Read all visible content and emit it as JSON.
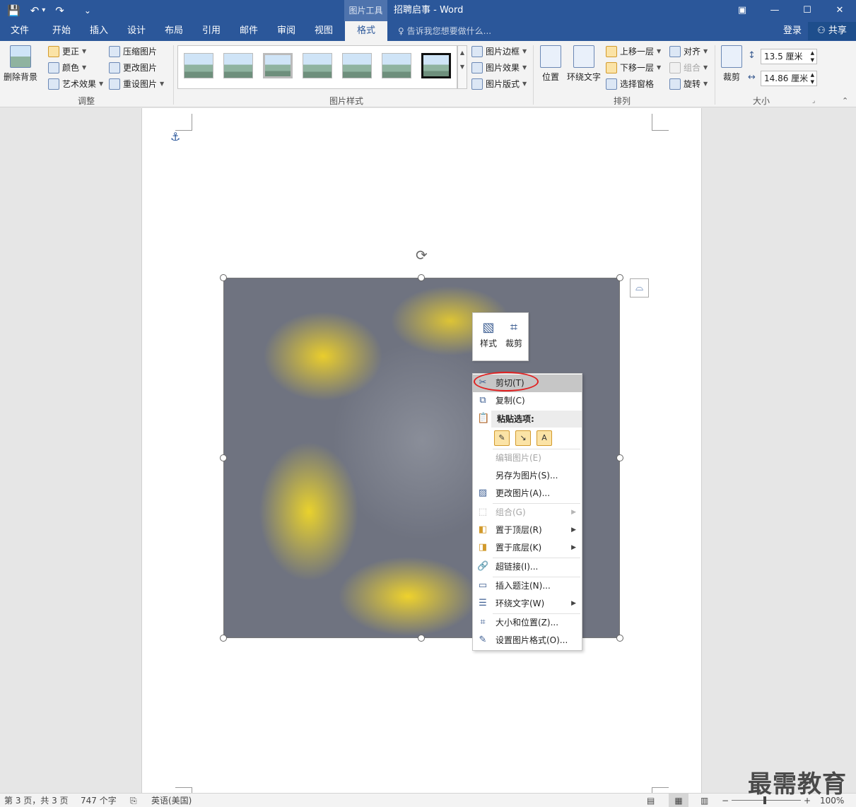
{
  "titlebar": {
    "qat": {
      "save": "💾",
      "undo": "↶",
      "undo_caret": "▾",
      "redo": "↷",
      "customize": "⌄"
    },
    "context_tool": "图片工具",
    "doc_title": "招聘启事 - Word",
    "ribbon_display": "▣",
    "minimize": "—",
    "maximize": "☐",
    "close": "✕"
  },
  "tabs": [
    {
      "label": "文件"
    },
    {
      "label": "开始"
    },
    {
      "label": "插入"
    },
    {
      "label": "设计"
    },
    {
      "label": "布局"
    },
    {
      "label": "引用"
    },
    {
      "label": "邮件"
    },
    {
      "label": "审阅"
    },
    {
      "label": "视图"
    },
    {
      "label": "格式"
    }
  ],
  "tell_me": "告诉我您想要做什么...",
  "login": "登录",
  "share": "共享",
  "ribbon": {
    "adjust": {
      "remove_bg": "删除背景",
      "corrections": "更正",
      "color": "颜色",
      "artistic": "艺术效果",
      "compress": "压缩图片",
      "change": "更改图片",
      "reset": "重设图片",
      "label": "调整"
    },
    "styles": {
      "border": "图片边框",
      "effects": "图片效果",
      "layout": "图片版式",
      "label": "图片样式"
    },
    "arrange": {
      "position": "位置",
      "wrap": "环绕文字",
      "bring_forward": "上移一层",
      "send_backward": "下移一层",
      "selection_pane": "选择窗格",
      "align": "对齐",
      "group": "组合",
      "rotate": "旋转",
      "label": "排列"
    },
    "size": {
      "crop": "裁剪",
      "height": "13.5 厘米",
      "width": "14.86 厘米",
      "label": "大小"
    }
  },
  "minibar": {
    "style": "样式",
    "crop": "裁剪"
  },
  "context_menu": {
    "cut": "剪切(T)",
    "copy": "复制(C)",
    "paste_options": "粘贴选项:",
    "edit_picture": "编辑图片(E)",
    "save_as_picture": "另存为图片(S)...",
    "change_picture": "更改图片(A)...",
    "group": "组合(G)",
    "bring_to_front": "置于顶层(R)",
    "send_to_back": "置于底层(K)",
    "hyperlink": "超链接(I)...",
    "insert_caption": "插入题注(N)...",
    "wrap_text": "环绕文字(W)",
    "size_position": "大小和位置(Z)...",
    "format_picture": "设置图片格式(O)..."
  },
  "statusbar": {
    "page": "第 3 页，共 3 页",
    "words": "747 个字",
    "language": "英语(美国)",
    "zoom_minus": "−",
    "zoom_plus": "+",
    "zoom": "100%"
  },
  "watermark": "最需教育"
}
